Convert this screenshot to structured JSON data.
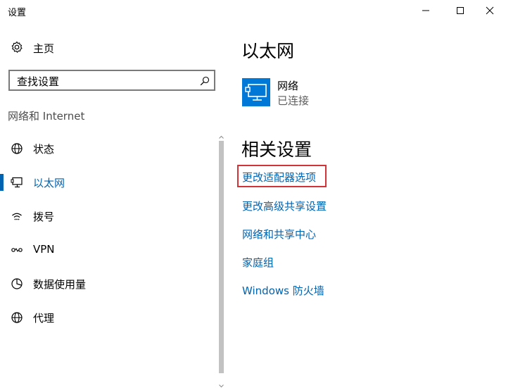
{
  "window": {
    "title": "设置",
    "minimize_glyph": "—",
    "maximize_glyph": "☐",
    "close_glyph": "✕"
  },
  "nav": {
    "home_label": "主页",
    "home_icon": "gear-icon",
    "search_placeholder": "查找设置",
    "search_icon": "search-icon",
    "section_header": "网络和 Internet",
    "items": [
      {
        "label": "状态",
        "icon": "globe-status-icon",
        "selected": false
      },
      {
        "label": "以太网",
        "icon": "ethernet-icon",
        "selected": true
      },
      {
        "label": "拨号",
        "icon": "dialup-icon",
        "selected": false
      },
      {
        "label": "VPN",
        "icon": "vpn-icon",
        "selected": false
      },
      {
        "label": "数据使用量",
        "icon": "data-usage-icon",
        "selected": false
      },
      {
        "label": "代理",
        "icon": "globe-proxy-icon",
        "selected": false
      }
    ]
  },
  "content": {
    "page_title": "以太网",
    "network": {
      "name": "网络",
      "status": "已连接",
      "icon": "monitor-network-icon"
    },
    "related_title": "相关设置",
    "links": [
      {
        "label": "更改适配器选项",
        "highlighted": true
      },
      {
        "label": "更改高级共享设置",
        "highlighted": false
      },
      {
        "label": "网络和共享中心",
        "highlighted": false
      },
      {
        "label": "家庭组",
        "highlighted": false
      },
      {
        "label": "Windows 防火墙",
        "highlighted": false
      }
    ]
  },
  "colors": {
    "accent": "#0078d7",
    "link": "#0063b1",
    "highlight_border": "#d13438"
  }
}
